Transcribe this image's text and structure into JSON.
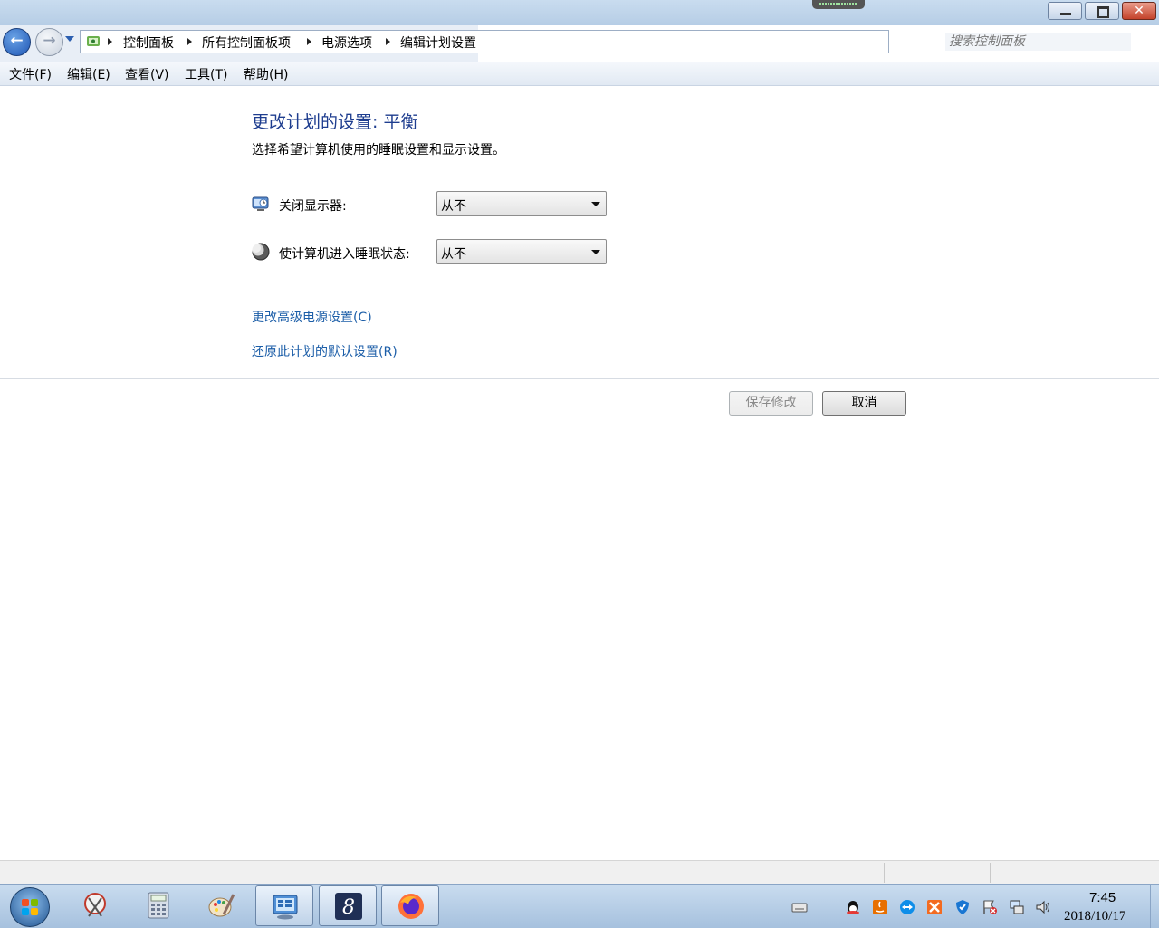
{
  "window": {
    "minimize": "–",
    "maximize": "❐",
    "close": "✕"
  },
  "nav": {
    "back": "←",
    "forward": "→",
    "breadcrumbs": [
      "控制面板",
      "所有控制面板项",
      "电源选项",
      "编辑计划设置"
    ],
    "search_placeholder": "搜索控制面板"
  },
  "menu": [
    "文件(F)",
    "编辑(E)",
    "查看(V)",
    "工具(T)",
    "帮助(H)"
  ],
  "main": {
    "title": "更改计划的设置: 平衡",
    "subtitle": "选择希望计算机使用的睡眠设置和显示设置。",
    "settings": [
      {
        "label": "关闭显示器:",
        "value": "从不",
        "icon": "monitor-icon"
      },
      {
        "label": "使计算机进入睡眠状态:",
        "value": "从不",
        "icon": "moon-icon"
      }
    ],
    "links": [
      "更改高级电源设置(C)",
      "还原此计划的默认设置(R)"
    ],
    "buttons": {
      "save": "保存修改",
      "cancel": "取消"
    }
  },
  "taskbar": {
    "clock_time": "7:45",
    "clock_date": "2018/10/17",
    "pinned": [
      "snipping-tool-icon",
      "calculator-icon",
      "paint-icon",
      "control-panel-icon",
      "scrivener-icon",
      "firefox-icon"
    ],
    "tray": [
      "keyboard-icon",
      "qq-icon",
      "java-icon",
      "teamviewer-icon",
      "xmind-icon",
      "shield-icon",
      "action-center-icon",
      "network-icon",
      "volume-icon"
    ]
  }
}
